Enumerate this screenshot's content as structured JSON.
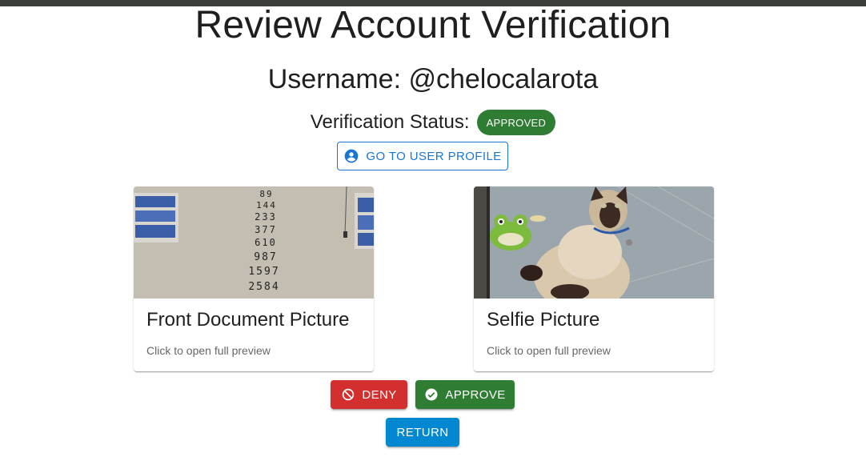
{
  "header": {
    "title": "Review Account Verification",
    "username": "Username: @chelocalarota"
  },
  "status": {
    "label": "Verification Status:",
    "badge": "APPROVED",
    "badge_color": "#2e7d32"
  },
  "profile_button": {
    "label": "GO TO USER PROFILE",
    "icon": "account-circle-icon"
  },
  "cards": {
    "front": {
      "title": "Front Document Picture",
      "subtitle": "Click to open full preview",
      "numbers": [
        "89",
        "144",
        "233",
        "377",
        "610",
        "987",
        "1597",
        "2584"
      ]
    },
    "selfie": {
      "title": "Selfie Picture",
      "subtitle": "Click to open full preview"
    }
  },
  "actions": {
    "deny_label": "DENY",
    "deny_icon": "block-icon",
    "deny_color": "#d32f2f",
    "approve_label": "APPROVE",
    "approve_icon": "check-circle-icon",
    "approve_color": "#2e7d32",
    "return_label": "RETURN",
    "return_color": "#0288d1"
  }
}
